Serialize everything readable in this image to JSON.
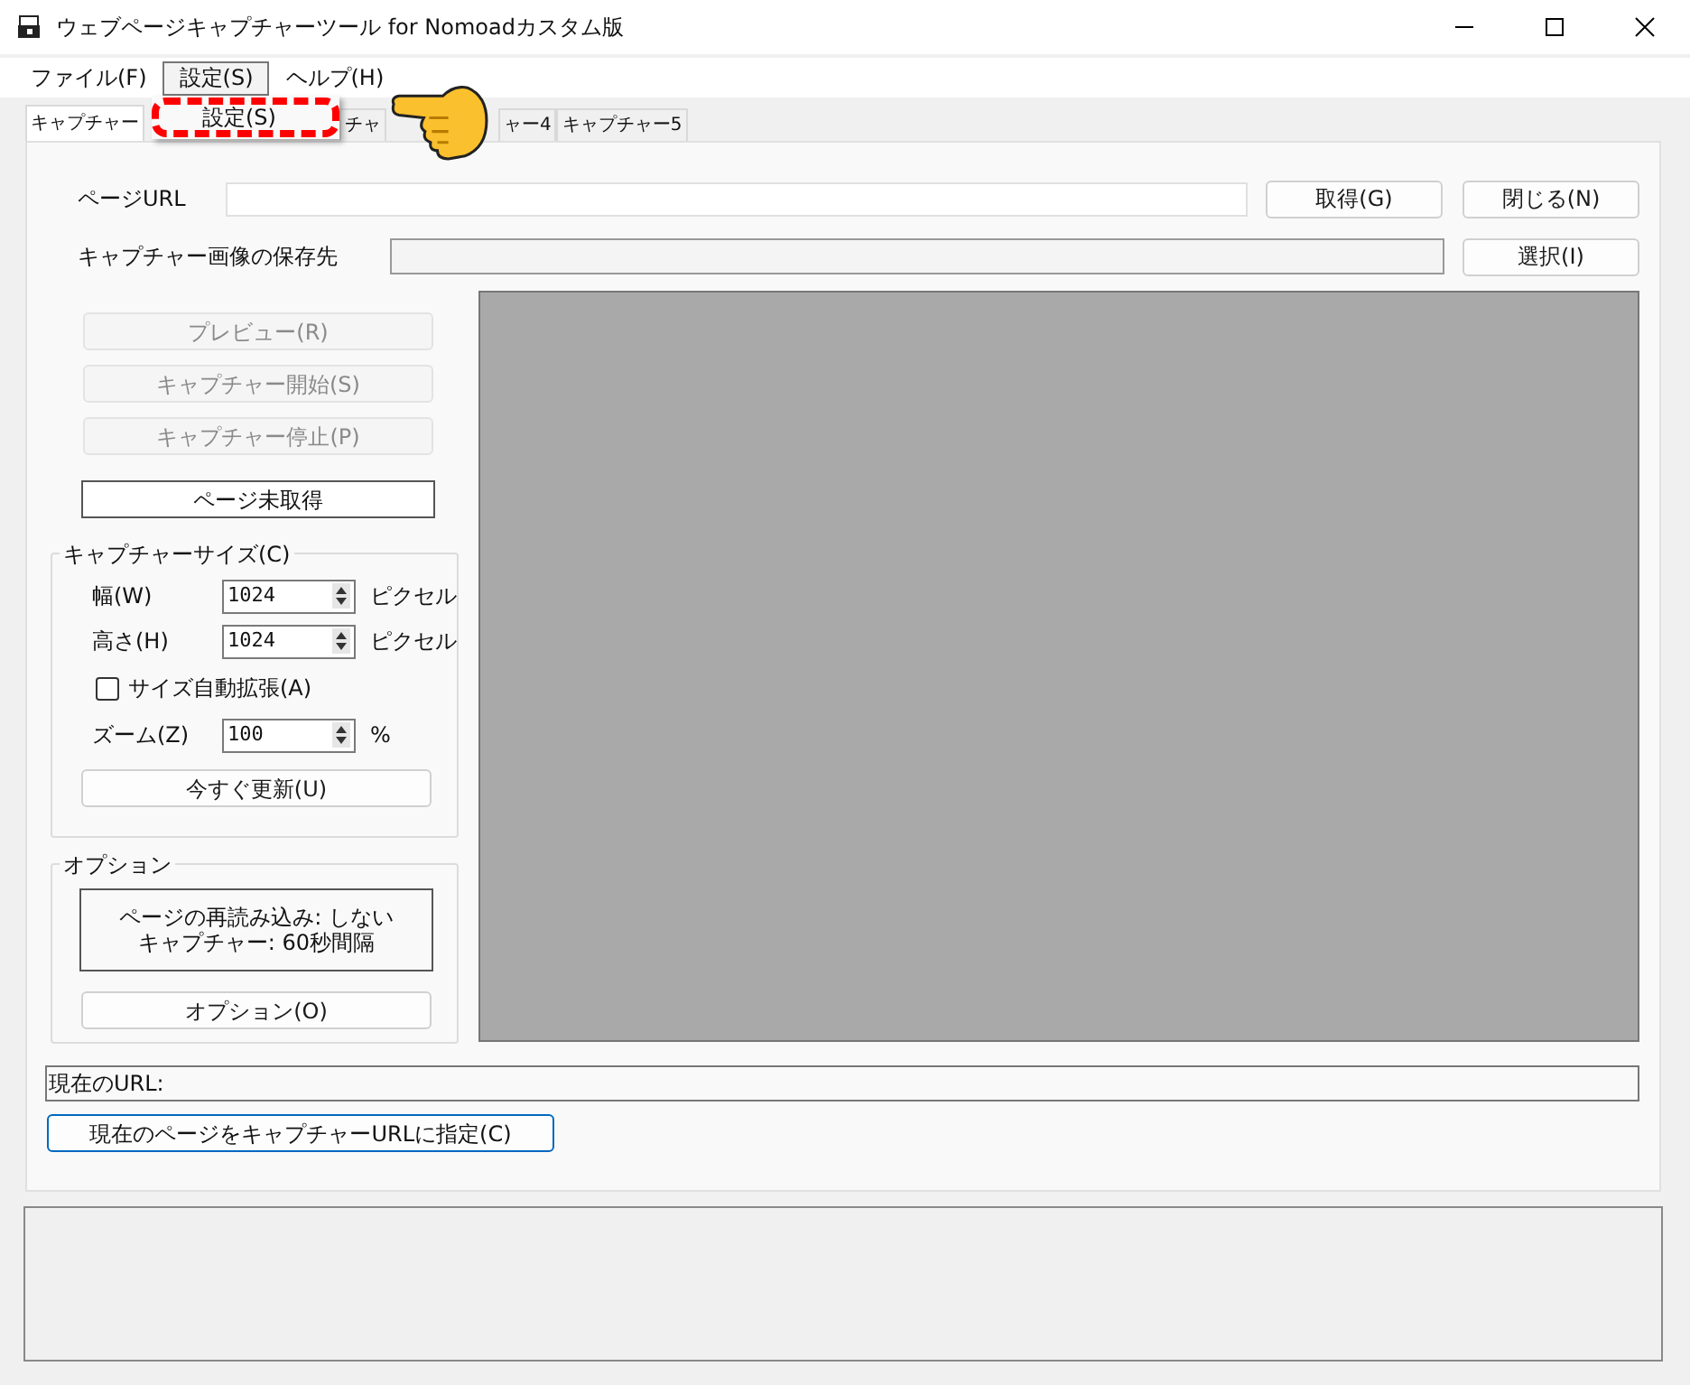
{
  "window": {
    "title": "ウェブページキャプチャーツール for Nomoadカスタム版"
  },
  "menu_bar": [
    {
      "label": "ファイル(F)",
      "selected": false
    },
    {
      "label": "設定(S)",
      "selected": true
    },
    {
      "label": "ヘルプ(H)",
      "selected": false
    }
  ],
  "dropdown_menu": {
    "items": [
      {
        "label": "設定(S)",
        "highlighted": true
      }
    ]
  },
  "tabs": [
    {
      "label": "キャプチャー",
      "selected": true
    },
    {
      "label": "チャ",
      "selected": false
    },
    {
      "label": "ャー4",
      "selected": false
    },
    {
      "label": "キャプチャー5",
      "selected": false
    }
  ],
  "page_url": {
    "label": "ページURL",
    "buttons": [
      "取得(G)",
      "閉じる(N)"
    ]
  },
  "save_location": {
    "label": "キャプチャー画像の保存先",
    "button": "選択(I)"
  },
  "capture_buttons": [
    {
      "label": "プレビュー(R)",
      "disabled": true
    },
    {
      "label": "キャプチャー開始(S)",
      "disabled": true
    },
    {
      "label": "キャプチャー停止(P)",
      "disabled": true
    }
  ],
  "status": "ページ未取得",
  "capture_size": {
    "title": "キャプチャーサイズ(C)",
    "fields": [
      {
        "label": "幅(W)",
        "value": "1024",
        "unit": "ピクセル"
      },
      {
        "label": "高さ(H)",
        "value": "1024",
        "unit": "ピクセル"
      }
    ],
    "auto_expand": {
      "label": "サイズ自動拡張(A)",
      "checked": false
    },
    "zoom": {
      "label": "ズーム(Z)",
      "value": "100",
      "unit": "%"
    },
    "update_button": "今すぐ更新(U)"
  },
  "options": {
    "title": "オプション",
    "summary": [
      "ページの再読み込み: しない",
      "キャプチャー: 60秒間隔"
    ],
    "button": "オプション(O)"
  },
  "current_url": {
    "label": "現在のURL:"
  },
  "set_url_button": "現在のページをキャプチャーURLに指定(C)"
}
